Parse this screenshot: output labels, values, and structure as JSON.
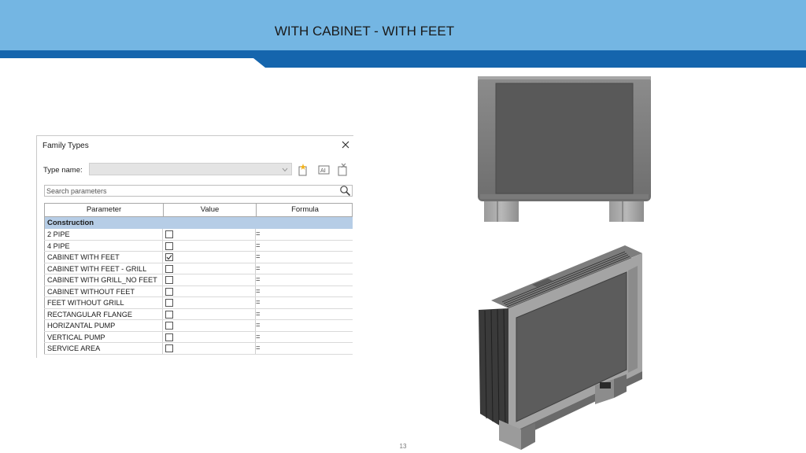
{
  "slide": {
    "title": "WITH CABINET - WITH FEET",
    "page_number": "13"
  },
  "dialog": {
    "title": "Family Types",
    "close_icon": "close-icon",
    "type_name_label": "Type name:",
    "type_name_value": "",
    "toolbar_icons": [
      "new-type-icon",
      "rename-type-icon",
      "delete-type-icon"
    ],
    "search_placeholder": "Search parameters",
    "columns": [
      "Parameter",
      "Value",
      "Formula"
    ],
    "group": "Construction",
    "rows": [
      {
        "name": "2 PIPE",
        "checked": false,
        "formula": "="
      },
      {
        "name": "4 PIPE",
        "checked": false,
        "formula": "="
      },
      {
        "name": "CABINET WITH FEET",
        "checked": true,
        "formula": "="
      },
      {
        "name": "CABINET WITH FEET - GRILL",
        "checked": false,
        "formula": "="
      },
      {
        "name": "CABINET WITH GRILL_NO FEET",
        "checked": false,
        "formula": "="
      },
      {
        "name": "CABINET WITHOUT FEET",
        "checked": false,
        "formula": "="
      },
      {
        "name": "FEET WITHOUT GRILL",
        "checked": false,
        "formula": "="
      },
      {
        "name": "RECTANGULAR FLANGE",
        "checked": false,
        "formula": "="
      },
      {
        "name": "HORIZANTAL PUMP",
        "checked": false,
        "formula": "="
      },
      {
        "name": "VERTICAL PUMP",
        "checked": false,
        "formula": "="
      },
      {
        "name": "SERVICE AREA",
        "checked": false,
        "formula": "="
      }
    ]
  },
  "colors": {
    "banner": "#74b6e3",
    "stripe": "#1565ad",
    "section_header": "#b6cde6"
  }
}
